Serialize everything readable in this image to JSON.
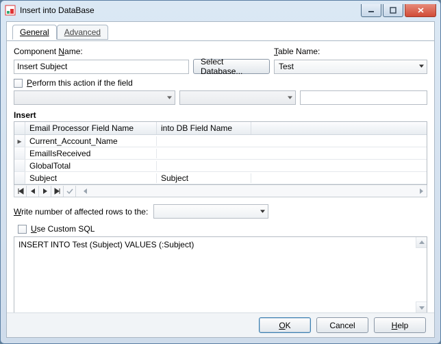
{
  "window": {
    "title": "Insert into DataBase"
  },
  "tabs": {
    "general": "General",
    "advanced": "Advanced"
  },
  "labels": {
    "component_pre": "Component ",
    "component_u": "N",
    "component_post": "ame:",
    "table_u": "T",
    "table_post": "able Name:",
    "select_db": "Select Database...",
    "perform_u": "P",
    "perform_post": "erform this action if the field",
    "insert": "Insert",
    "write_u": "W",
    "write_post": "rite number of affected rows to the:",
    "custom_u": "U",
    "custom_post": "se Custom SQL"
  },
  "fields": {
    "component_name": "Insert Subject",
    "table_name": "Test"
  },
  "grid": {
    "col1": "Email Processor Field Name",
    "col2": "into DB Field Name",
    "rows": [
      {
        "c1": "Current_Account_Name",
        "c2": ""
      },
      {
        "c1": "EmailIsReceived",
        "c2": ""
      },
      {
        "c1": "GlobalTotal",
        "c2": ""
      },
      {
        "c1": "Subject",
        "c2": "Subject"
      }
    ]
  },
  "sql": "INSERT INTO Test (Subject) VALUES (:Subject)",
  "footer": {
    "ok_u": "O",
    "ok_post": "K",
    "cancel": "Cancel",
    "help_u": "H",
    "help_post": "elp"
  }
}
